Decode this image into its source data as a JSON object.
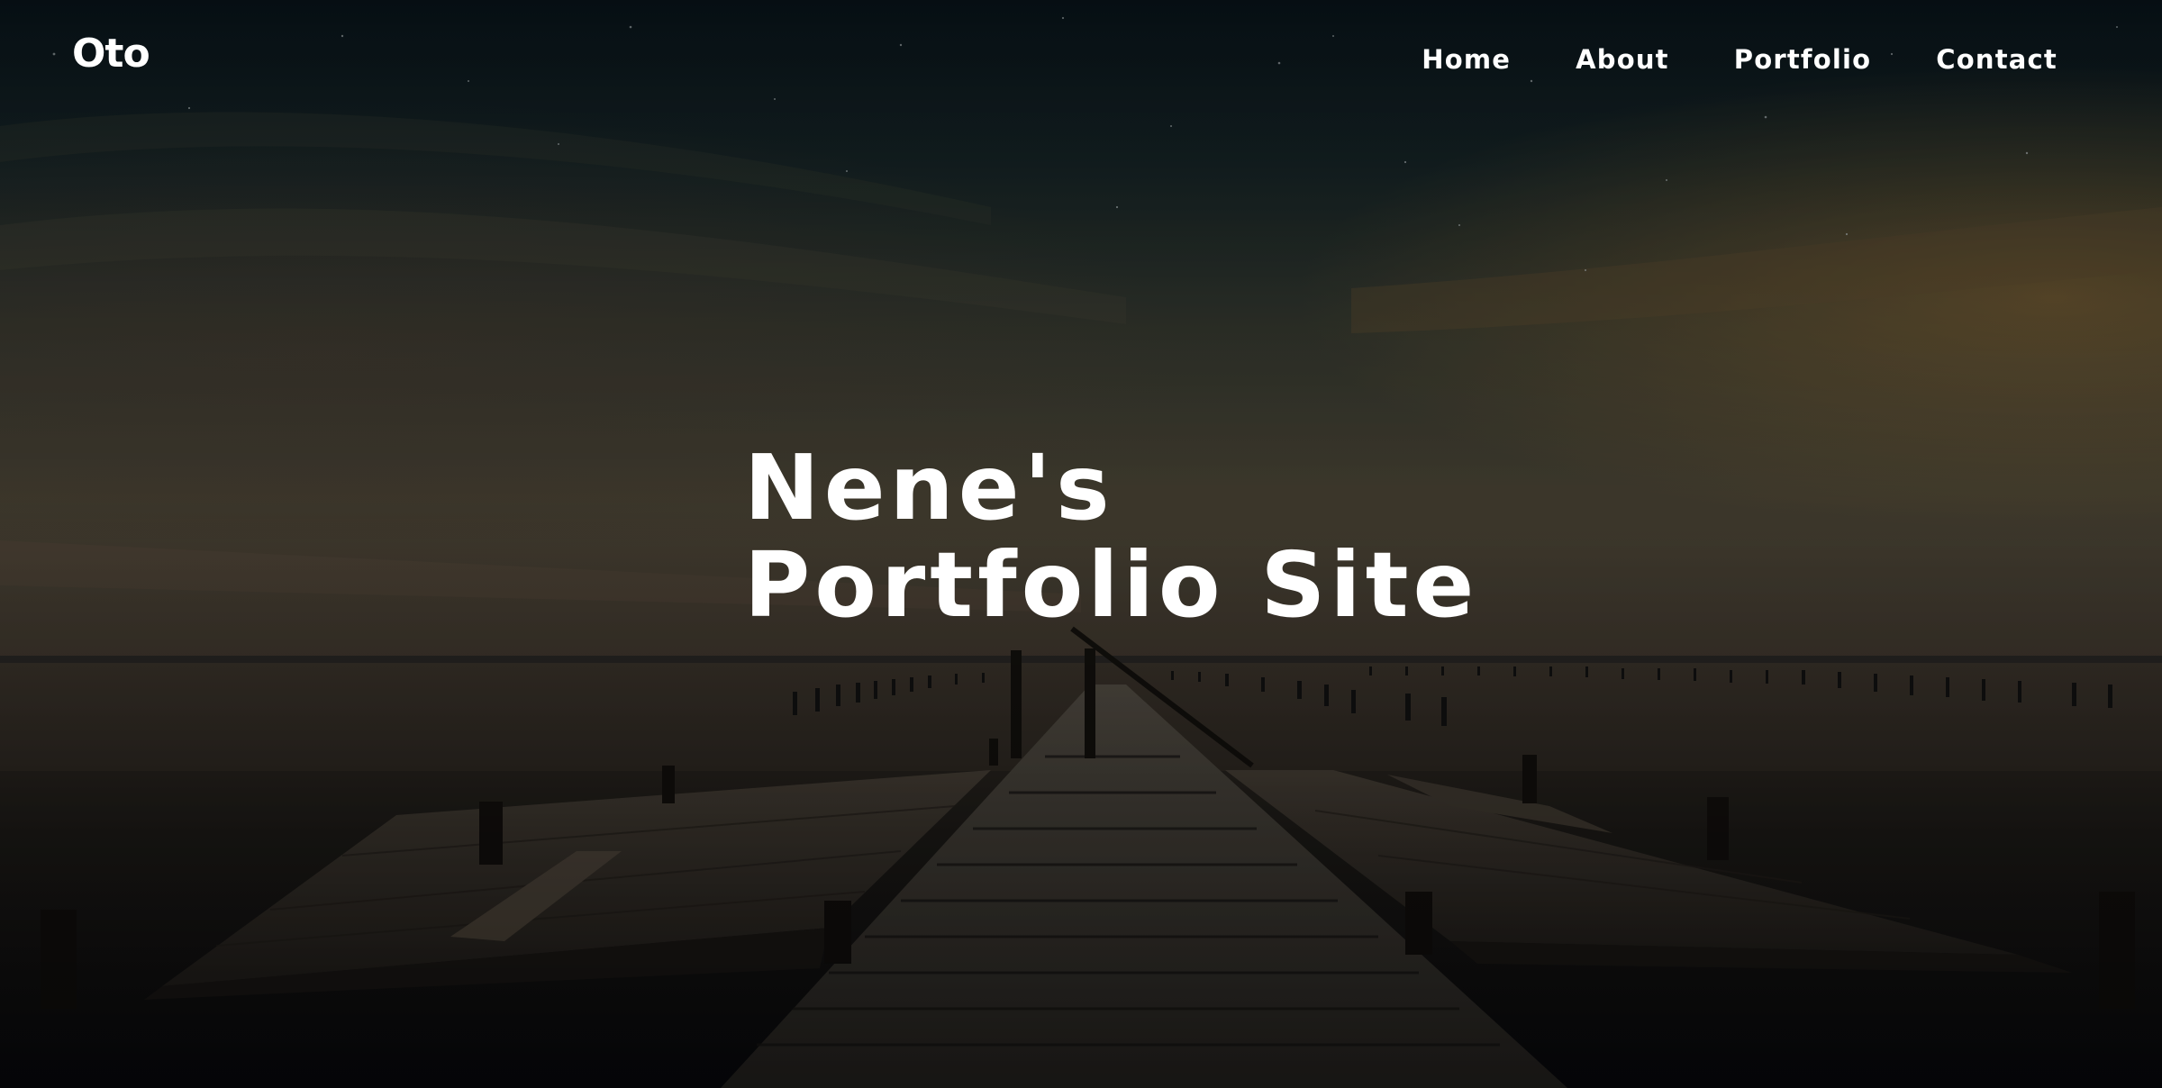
{
  "header": {
    "logo": "Oto",
    "nav": [
      {
        "label": "Home"
      },
      {
        "label": "About"
      },
      {
        "label": "Portfolio"
      },
      {
        "label": "Contact"
      }
    ]
  },
  "hero": {
    "title_line1": "Nene's",
    "title_line2": "Portfolio Site",
    "background_description_colors": {
      "sky_top": "#0b1a24",
      "horizon_glow": "#6a5a3a",
      "water": "#1d1a16",
      "pier": "#4a433a"
    }
  }
}
